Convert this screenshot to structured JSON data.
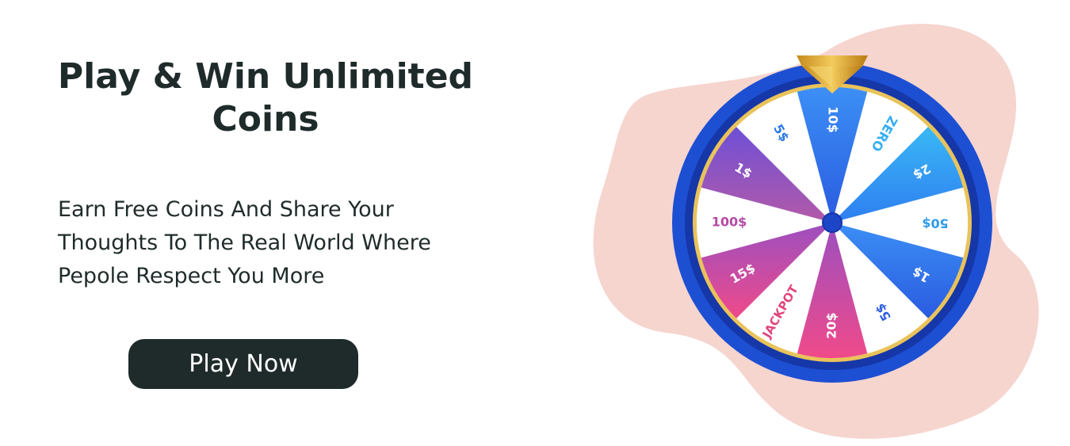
{
  "hero": {
    "title": "Play & Win Unlimited Coins",
    "description": "Earn Free Coins And Share Your Thoughts To The Real World Where Pepole Respect You More",
    "cta_label": "Play Now"
  },
  "wheel": {
    "segments": [
      "10$",
      "ZERO",
      "2$",
      "50$",
      "1$",
      "5$",
      "20$",
      "JACKPOT",
      "15$",
      "100$",
      "1$",
      "5$"
    ]
  },
  "colors": {
    "text_dark": "#1f2b2a",
    "button_bg": "#1f2b2a",
    "blob_pink": "#f6d5cf",
    "rim_blue": "#1d4fd3",
    "pointer_gold": "#d8a42a",
    "hub_blue": "#1c45c8"
  },
  "icons": [
    "wheel-pointer-icon"
  ]
}
